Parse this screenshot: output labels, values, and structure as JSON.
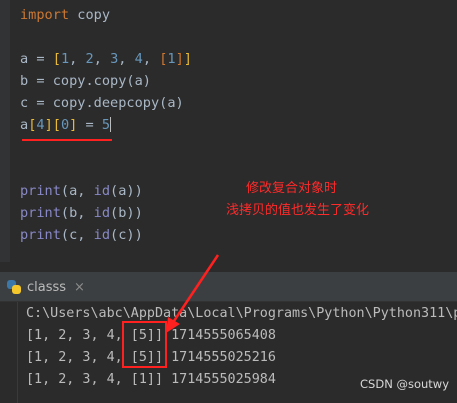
{
  "editor": {
    "lines": {
      "import": {
        "kw": "import",
        "rest": " copy"
      },
      "a_assign": {
        "lhs": "a = ",
        "open": "[",
        "v1": "1",
        "v2": "2",
        "v3": "3",
        "v4": "4",
        "inner_open": "[",
        "v5": "1",
        "inner_close": "]",
        "close": "]",
        "sep": ", "
      },
      "b_assign": {
        "text": "b = copy.copy(a)"
      },
      "c_assign": {
        "text": "c = copy.deepcopy(a)"
      },
      "modify": {
        "a": "a",
        "i1": "[",
        "n4": "4",
        "i2": "][",
        "n0": "0",
        "i3": "]",
        "eq": " = ",
        "n5": "5"
      },
      "print_a": {
        "fn": "print",
        "args": "(a, ",
        "id": "id",
        "tail": "(a))"
      },
      "print_b": {
        "fn": "print",
        "args": "(b, ",
        "id": "id",
        "tail": "(b))"
      },
      "print_c": {
        "fn": "print",
        "args": "(c, ",
        "id": "id",
        "tail": "(c))"
      }
    }
  },
  "annotation": {
    "line1": "修改复合对象时",
    "line2": "浅拷贝的值也发生了变化"
  },
  "run_panel": {
    "tab_label": "classs",
    "close_glyph": "×"
  },
  "console": {
    "path": "C:\\Users\\abc\\AppData\\Local\\Programs\\Python\\Python311\\p",
    "output": [
      "[1, 2, 3, 4, [5]] 1714555065408",
      "[1, 2, 3, 4, [5]] 1714555025216",
      "[1, 2, 3, 4, [1]] 1714555025984"
    ]
  },
  "watermark": "CSDN @soutwy",
  "colors": {
    "background": "#2b2b2b",
    "keyword": "#cc7832",
    "number": "#6897bb",
    "annotation_red": "#ff2020"
  }
}
